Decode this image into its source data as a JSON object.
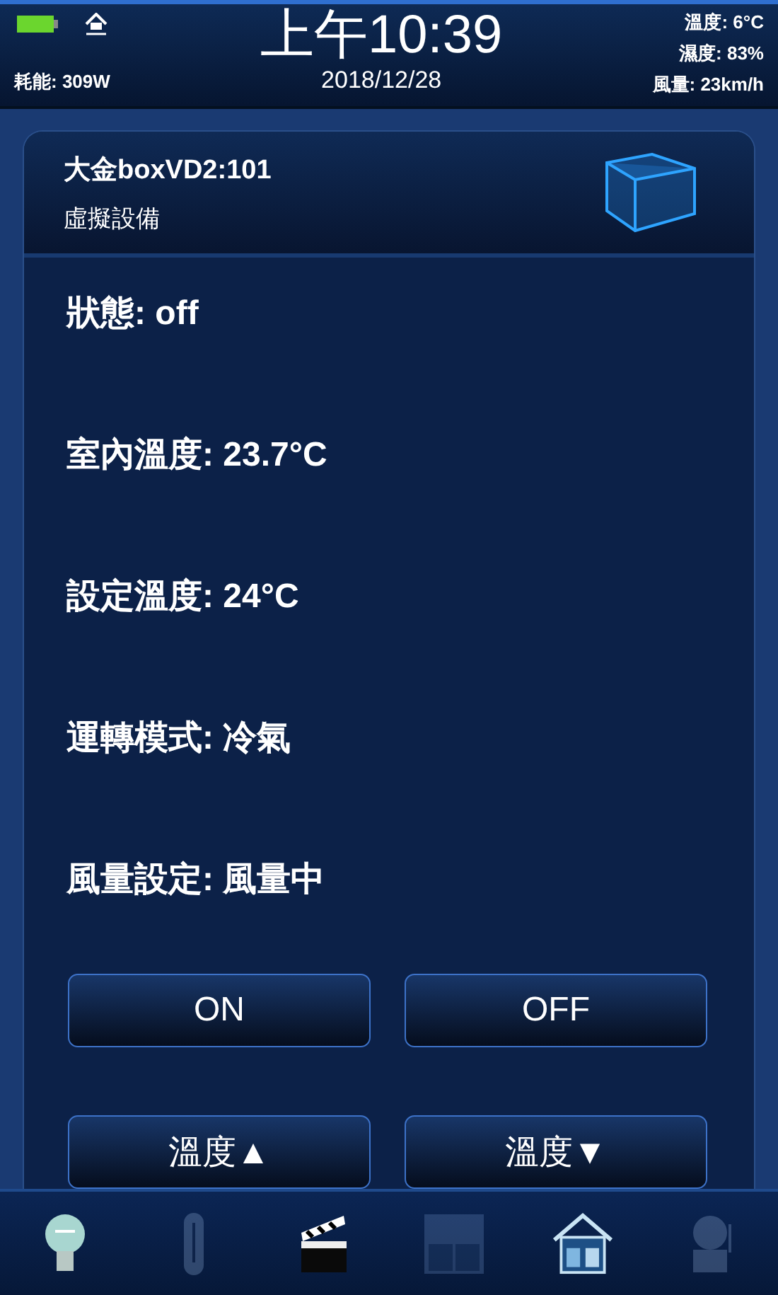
{
  "status_bar": {
    "power": "耗能: 309W",
    "time": "上午10:39",
    "date": "2018/12/28",
    "weather": [
      "溫度: 6°C",
      "濕度: 83%",
      "風量: 23km/h"
    ]
  },
  "device": {
    "name": "大金boxVD2:101",
    "type": "虛擬設備"
  },
  "properties": [
    {
      "label": "狀態:",
      "value": "off"
    },
    {
      "label": "室內溫度:",
      "value": "23.7°C"
    },
    {
      "label": "設定溫度:",
      "value": "24°C"
    },
    {
      "label": "運轉模式:",
      "value": "冷氣"
    },
    {
      "label": "風量設定:",
      "value": "風量中"
    }
  ],
  "buttons": [
    "ON",
    "OFF",
    "溫度▲",
    "溫度▼"
  ],
  "nav": [
    {
      "kind": "bulb",
      "enabled": true
    },
    {
      "kind": "thermometer",
      "enabled": false
    },
    {
      "kind": "clapper",
      "enabled": true
    },
    {
      "kind": "curtain",
      "enabled": false
    },
    {
      "kind": "house",
      "enabled": true
    },
    {
      "kind": "bell",
      "enabled": false
    }
  ]
}
